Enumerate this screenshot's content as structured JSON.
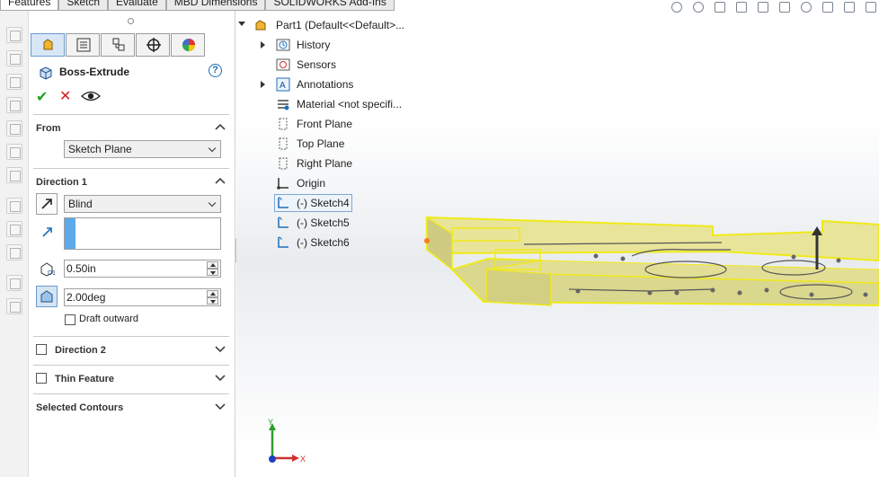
{
  "command_tabs": [
    "Features",
    "Sketch",
    "Evaluate",
    "MBD Dimensions",
    "SOLIDWORKS Add-Ins"
  ],
  "property_manager": {
    "feature_name": "Boss-Extrude",
    "help": "?",
    "from": {
      "title": "From",
      "value": "Sketch Plane"
    },
    "direction1": {
      "title": "Direction 1",
      "end_condition": "Blind",
      "depth": "0.50in",
      "draft_angle": "2.00deg",
      "draft_outward_label": "Draft outward"
    },
    "direction2": {
      "title": "Direction 2"
    },
    "thin_feature": {
      "title": "Thin Feature"
    },
    "selected_contours": {
      "title": "Selected Contours"
    }
  },
  "tree": {
    "root": "Part1  (Default<<Default>...",
    "items": [
      {
        "label": "History"
      },
      {
        "label": "Sensors"
      },
      {
        "label": "Annotations"
      },
      {
        "label": "Material <not specifi..."
      },
      {
        "label": "Front Plane"
      },
      {
        "label": "Top Plane"
      },
      {
        "label": "Right Plane"
      },
      {
        "label": "Origin"
      },
      {
        "label": "(-) Sketch4"
      },
      {
        "label": "(-) Sketch5"
      },
      {
        "label": "(-) Sketch6"
      }
    ]
  },
  "triad": {
    "x": "X",
    "y": "Y"
  },
  "colors": {
    "preview_fill": "#e8e49a",
    "preview_edge": "#f0ea1a",
    "accent_blue": "#1d6fb8"
  }
}
